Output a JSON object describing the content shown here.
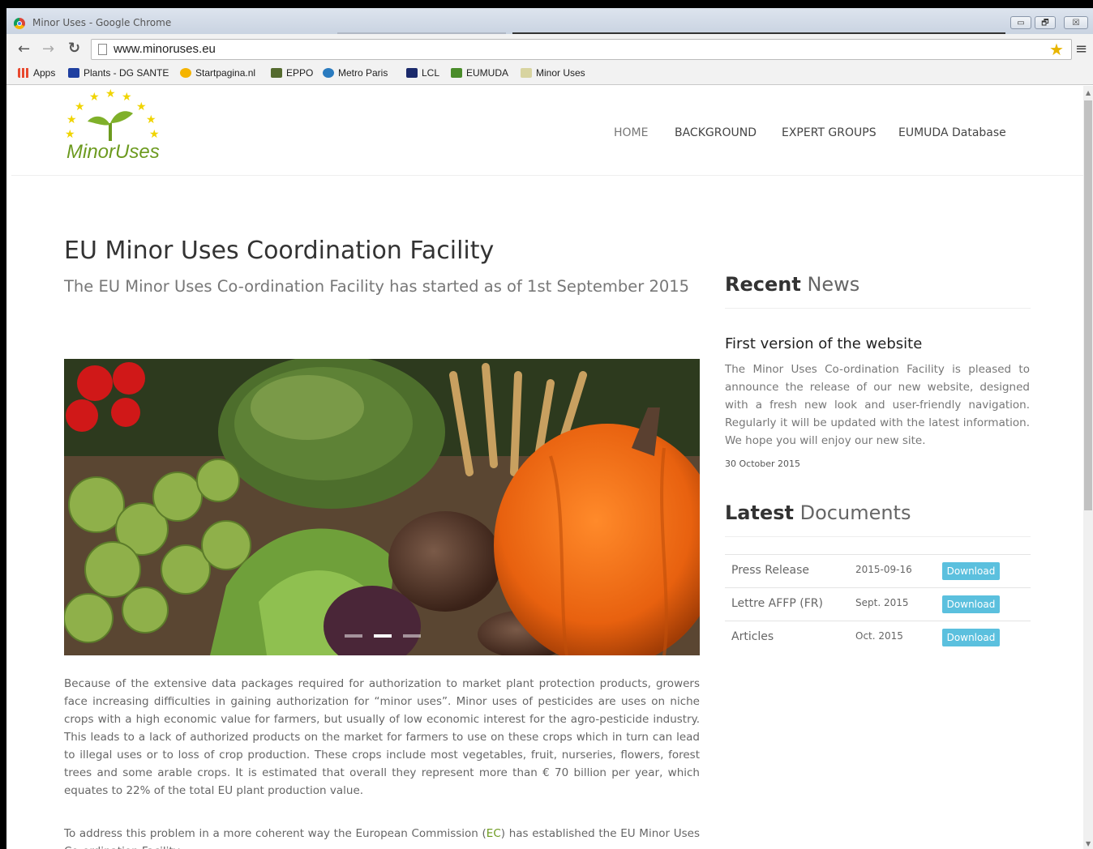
{
  "window": {
    "title": "Minor Uses - Google Chrome",
    "controls": {
      "minimize": "▭",
      "restore": "🗗",
      "close": "☒"
    }
  },
  "browser": {
    "url": "www.minoruses.eu",
    "back_icon": "back-arrow-icon",
    "forward_icon": "forward-arrow-icon",
    "reload_icon": "reload-icon"
  },
  "bookmarks": [
    {
      "label": "Apps",
      "icon": "apps-grid-icon",
      "color": "#e8492f"
    },
    {
      "label": "Plants - DG SANTE",
      "icon": "eu-flag-icon",
      "color": "#1f3fa0"
    },
    {
      "label": "Startpagina.nl",
      "icon": "startpagina-s-icon",
      "color": "#f5b400"
    },
    {
      "label": "EPPO",
      "icon": "eppo-icon",
      "color": "#556b2f"
    },
    {
      "label": "Metro Paris",
      "icon": "metro-icon",
      "color": "#2a7bbf"
    },
    {
      "label": "LCL",
      "icon": "lcl-icon",
      "color": "#1b2a6b"
    },
    {
      "label": "EUMUDA",
      "icon": "eumuda-icon",
      "color": "#4a8c2a"
    },
    {
      "label": "Minor Uses",
      "icon": "minoruses-icon",
      "color": "#d8d4a0"
    }
  ],
  "site": {
    "logo_text": "MinorUses",
    "nav": [
      "HOME",
      "BACKGROUND",
      "EXPERT GROUPS",
      "EUMUDA Database"
    ],
    "heading": "EU Minor Uses Coordination Facility",
    "subheading": "The EU Minor Uses Co-ordination Facility has started as of 1st September 2015",
    "paragraph1": "Because of the extensive data packages required for authorization to market plant protection products, growers face increasing difficulties in gaining authorization for “minor uses”.  Minor uses of pesticides are uses on niche crops with a high economic value for farmers, but usually of low economic interest for the agro-pesticide industry. This leads to a lack of authorized products on the market for farmers to use on these crops which in turn can lead to illegal uses or to loss of crop production. These crops include most vegetables, fruit, nurseries, flowers, forest trees and some arable crops. It is estimated that overall they represent more than € 70 billion per year, which equates to 22% of the total EU plant production value.",
    "paragraph2_before": "To address this problem in a more coherent way the European Commission (",
    "paragraph2_link": "EC",
    "paragraph2_after": ") has established the EU Minor Uses Co-ordination Facility.",
    "carousel_slides": 3,
    "carousel_active": 2
  },
  "sidebar": {
    "news_heading_bold": "Recent",
    "news_heading_light": " News",
    "news_title": "First version of the website",
    "news_body": "The Minor Uses Co-ordination Facility is pleased to announce the release of our new website, designed with a fresh new look and user-friendly navigation. Regularly it will be updated with the latest information. We hope you will enjoy our new site.",
    "news_date": "30 October 2015",
    "docs_heading_bold": "Latest",
    "docs_heading_light": " Documents",
    "documents": [
      {
        "name": "Press Release",
        "date": "2015-09-16",
        "button": "Download"
      },
      {
        "name": "Lettre AFFP (FR)",
        "date": "Sept. 2015",
        "button": "Download"
      },
      {
        "name": "Articles",
        "date": "Oct. 2015",
        "button": "Download"
      }
    ]
  },
  "colors": {
    "accent_green": "#6c9a1f",
    "download_button": "#5bc0de",
    "logo_stars": "#f0d400"
  }
}
